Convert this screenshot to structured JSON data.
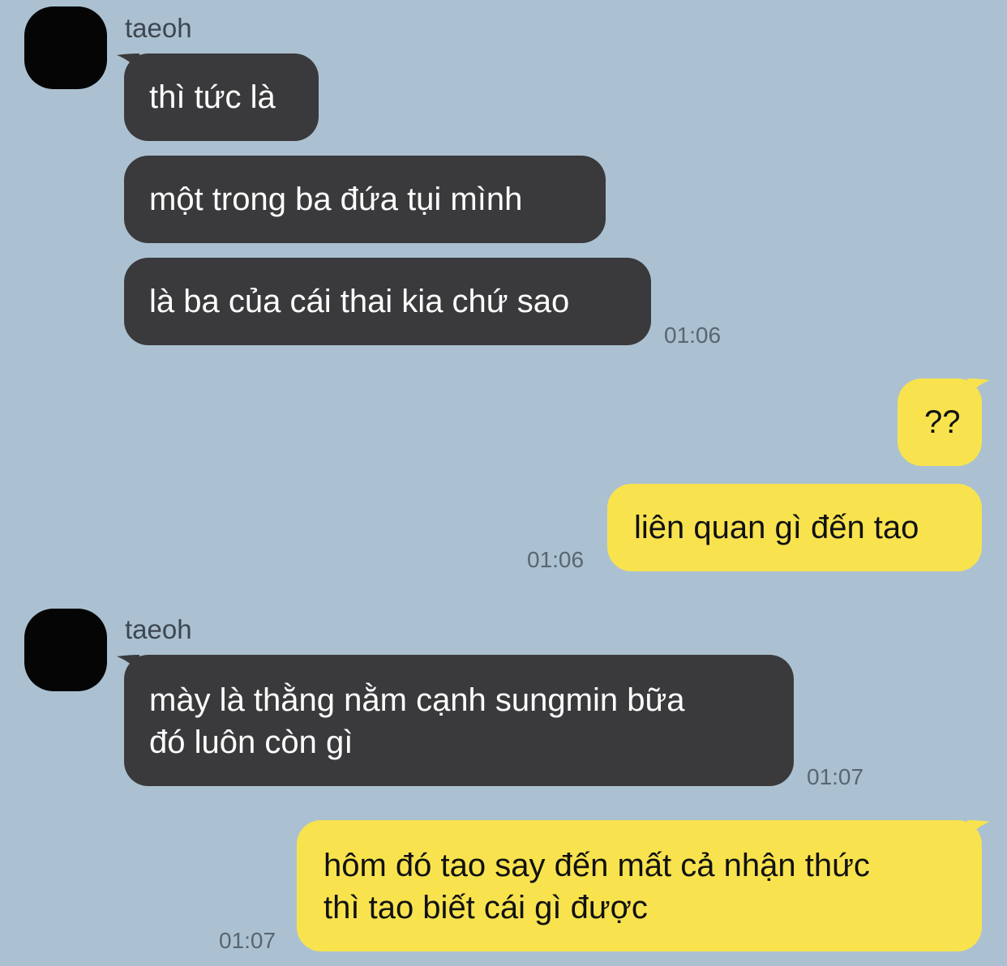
{
  "colors": {
    "background": "#abc1d1",
    "incoming_bubble": "#3a3a3c",
    "outgoing_bubble": "#f8e34f",
    "incoming_text": "#ffffff",
    "outgoing_text": "#111111",
    "timestamp": "#5a6570"
  },
  "groups": [
    {
      "sender": "taeoh",
      "avatar_icon": "avatar-icon",
      "messages": [
        {
          "lines": [
            "thì tức là"
          ]
        },
        {
          "lines": [
            "một trong ba đứa tụi mình"
          ]
        },
        {
          "lines": [
            "là ba của cái thai kia chứ sao"
          ],
          "time": "01:06"
        }
      ]
    },
    {
      "sender": "me",
      "messages": [
        {
          "lines": [
            "??"
          ]
        },
        {
          "lines": [
            "liên quan gì đến tao"
          ],
          "time": "01:06"
        }
      ]
    },
    {
      "sender": "taeoh",
      "avatar_icon": "avatar-icon",
      "messages": [
        {
          "lines": [
            "mày là thằng nằm cạnh sungmin bữa",
            "đó luôn còn gì"
          ],
          "time": "01:07"
        }
      ]
    },
    {
      "sender": "me",
      "messages": [
        {
          "lines": [
            "hôm đó tao say đến mất cả nhận thức",
            "thì tao biết cái gì được"
          ],
          "time": "01:07"
        }
      ]
    }
  ]
}
